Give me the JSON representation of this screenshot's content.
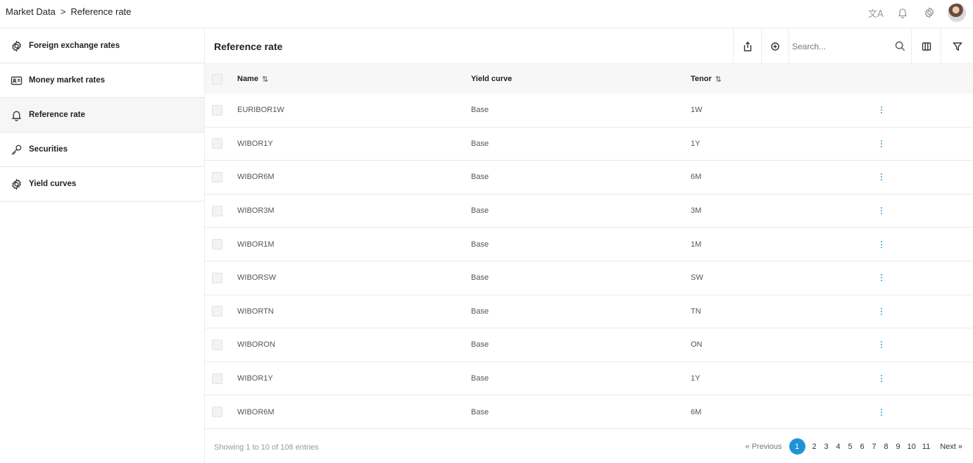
{
  "breadcrumb": {
    "parent": "Market Data",
    "separator": ">",
    "current": "Reference rate"
  },
  "top_icons": [
    "translate-icon",
    "bell-icon",
    "gear-icon",
    "avatar"
  ],
  "sidebar": {
    "items": [
      {
        "label": "Foreign exchange rates",
        "icon": "gear-cog-icon",
        "active": false
      },
      {
        "label": "Money market rates",
        "icon": "id-card-icon",
        "active": false
      },
      {
        "label": "Reference rate",
        "icon": "bell-icon",
        "active": true
      },
      {
        "label": "Securities",
        "icon": "key-icon",
        "active": false
      },
      {
        "label": "Yield curves",
        "icon": "gear-cog-icon",
        "active": false
      }
    ]
  },
  "panel": {
    "title": "Reference rate",
    "search_placeholder": "Search..."
  },
  "table": {
    "headers": {
      "name": "Name",
      "yield_curve": "Yield curve",
      "tenor": "Tenor",
      "sort_glyph": "⇅"
    },
    "rows": [
      {
        "name": "EURIBOR1W",
        "yield_curve": "Base",
        "tenor": "1W"
      },
      {
        "name": "WIBOR1Y",
        "yield_curve": "Base",
        "tenor": "1Y"
      },
      {
        "name": "WIBOR6M",
        "yield_curve": "Base",
        "tenor": "6M"
      },
      {
        "name": "WIBOR3M",
        "yield_curve": "Base",
        "tenor": "3M"
      },
      {
        "name": "WIBOR1M",
        "yield_curve": "Base",
        "tenor": "1M"
      },
      {
        "name": "WIBORSW",
        "yield_curve": "Base",
        "tenor": "SW"
      },
      {
        "name": "WIBORTN",
        "yield_curve": "Base",
        "tenor": "TN"
      },
      {
        "name": "WIBORON",
        "yield_curve": "Base",
        "tenor": "ON"
      },
      {
        "name": "WIBOR1Y",
        "yield_curve": "Base",
        "tenor": "1Y"
      },
      {
        "name": "WIBOR6M",
        "yield_curve": "Base",
        "tenor": "6M"
      }
    ]
  },
  "footer": {
    "showing": "Showing 1 to 10 of 108 entries",
    "previous": "« Previous",
    "pages": [
      "1",
      "2",
      "3",
      "4",
      "5",
      "6",
      "7",
      "8",
      "9",
      "10",
      "11"
    ],
    "current_page": "1",
    "next": "Next »"
  },
  "colors": {
    "accent": "#1e94d8",
    "kebab": "#3a9ad9",
    "active_bg": "#f6f6f7"
  }
}
